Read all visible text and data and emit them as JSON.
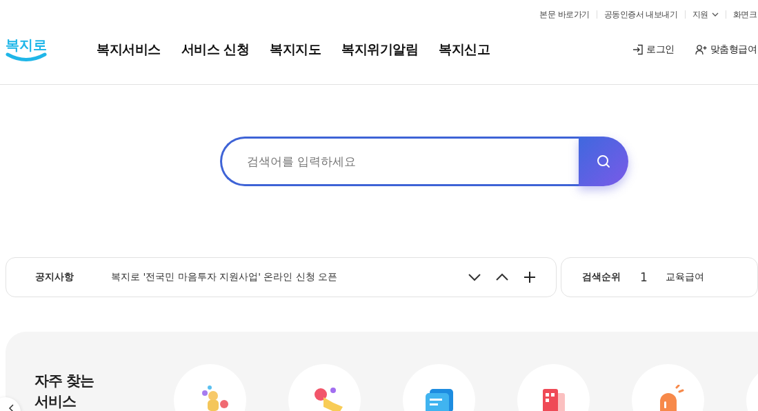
{
  "logo": {
    "text": "복지로"
  },
  "utility_links": [
    {
      "label": "본문 바로가기",
      "kind": "link"
    },
    {
      "label": "공동인증서 내보내기",
      "kind": "link"
    },
    {
      "label": "지원",
      "kind": "dropdown"
    },
    {
      "label": "화면크",
      "kind": "link"
    }
  ],
  "nav": [
    "복지서비스",
    "서비스 신청",
    "복지지도",
    "복지위기알림",
    "복지신고"
  ],
  "account_links": [
    {
      "label": "로그인",
      "kind": "login"
    },
    {
      "label": "맞춤형급여",
      "kind": "person"
    }
  ],
  "search": {
    "placeholder": "검색어를 입력하세요"
  },
  "notice": {
    "label": "공지사항",
    "text": "복지로 '전국민 마음투자 지원사업' 온라인 신청 오픈"
  },
  "ranking": {
    "label": "검색순위",
    "rank": "1",
    "term": "교육급여"
  },
  "frequent": {
    "title": "자주 찾는 서비스",
    "services": [
      {
        "kind": "people"
      },
      {
        "kind": "hand"
      },
      {
        "kind": "chat"
      },
      {
        "kind": "building"
      },
      {
        "kind": "siren"
      },
      {
        "kind": "blank"
      }
    ]
  }
}
